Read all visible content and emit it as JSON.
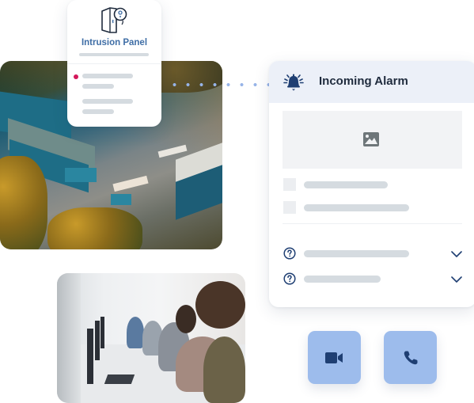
{
  "intrusion_panel": {
    "title": "Intrusion Panel",
    "icon": "door-sensor-icon",
    "status_dot_color": "#d3175a",
    "accent_color": "#3f6ea6"
  },
  "alarm": {
    "title": "Incoming Alarm",
    "header_icon": "bell-alarm-icon",
    "image_placeholder_icon": "image-icon",
    "rows": [
      {
        "icon": "help-circle-icon",
        "expand_icon": "chevron-down-icon"
      },
      {
        "icon": "help-circle-icon",
        "expand_icon": "chevron-down-icon"
      }
    ],
    "header_bg": "#ecf0f8",
    "icon_color": "#1f3f73"
  },
  "actions": {
    "video_icon": "video-camera-icon",
    "phone_icon": "phone-icon",
    "button_color": "#9dbcec"
  },
  "photos": {
    "warehouse": "aerial-warehouse-photo",
    "callcenter": "call-center-operators-photo"
  }
}
